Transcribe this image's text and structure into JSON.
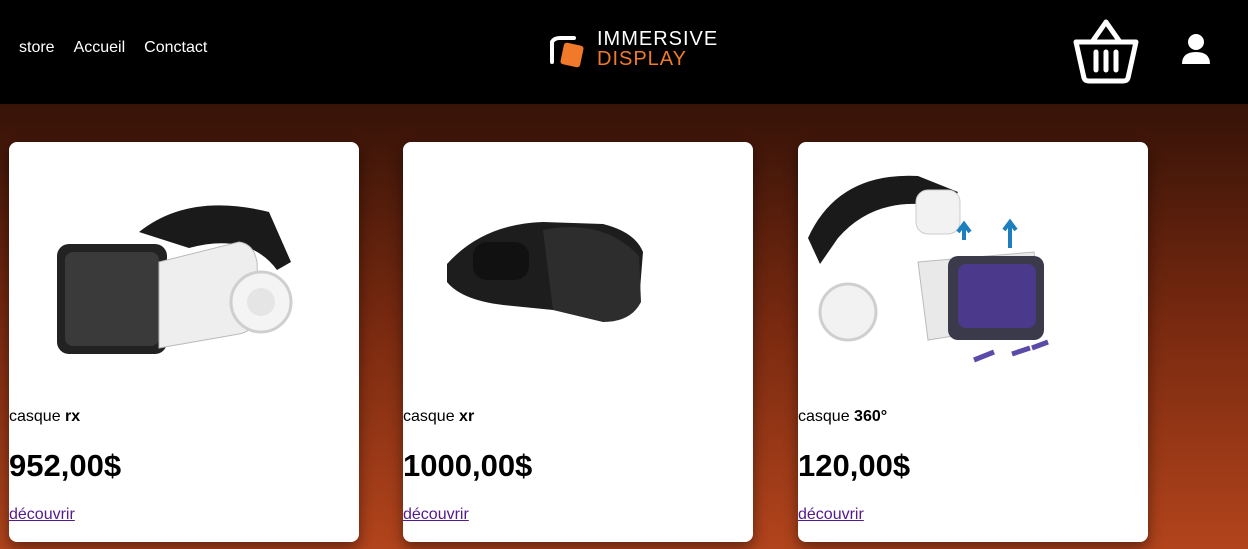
{
  "nav": {
    "items": [
      "store",
      "Accueil",
      "Conctact"
    ]
  },
  "brand": {
    "line1": "IMMERSIVE",
    "line2": "DISPLAY",
    "accent": "#f07a2a"
  },
  "header_icons": {
    "cart": "basket-icon",
    "account": "user-icon"
  },
  "products": [
    {
      "name_prefix": "casque",
      "name_strong": "rx",
      "price": "952,00$",
      "link": "découvrir"
    },
    {
      "name_prefix": "casque",
      "name_strong": "xr",
      "price": "1000,00$",
      "link": "découvrir"
    },
    {
      "name_prefix": "casque",
      "name_strong": "360°",
      "price": "120,00$",
      "link": "découvrir"
    }
  ]
}
